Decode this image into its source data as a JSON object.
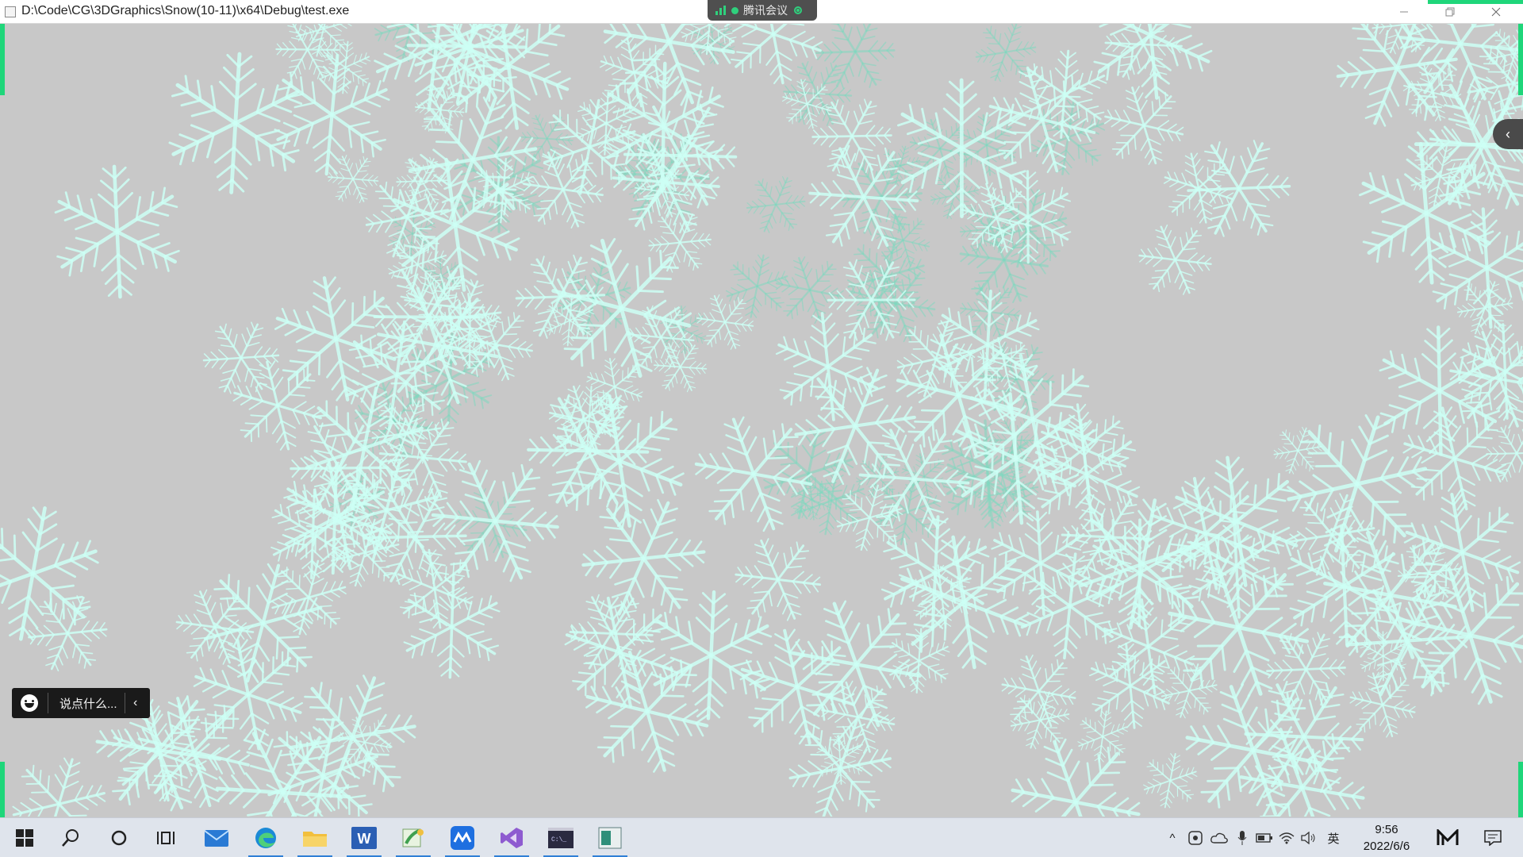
{
  "window": {
    "title": "D:\\Code\\CG\\3DGraphics\\Snow(10-11)\\x64\\Debug\\test.exe",
    "minimize_icon": "minimize-icon",
    "restore_icon": "restore-icon",
    "close_icon": "close-icon"
  },
  "meeting": {
    "label": "腾讯会议",
    "accent": "#2fd07d"
  },
  "canvas": {
    "background": "#c8c8c8",
    "content": "animated snowflakes",
    "flake_color": "#ccfff4",
    "flake_dim_color": "#7fd8bf"
  },
  "chat": {
    "placeholder": "说点什么...",
    "emoji_icon": "emoji-icon",
    "collapse_icon": "chevron-left-icon"
  },
  "side_tab": {
    "icon": "chevron-left-icon"
  },
  "taskbar": {
    "apps": [
      {
        "name": "start",
        "icon": "windows-icon"
      },
      {
        "name": "search",
        "icon": "search-icon"
      },
      {
        "name": "cortana",
        "icon": "cortana-icon"
      },
      {
        "name": "task-view",
        "icon": "task-view-icon"
      },
      {
        "name": "mail",
        "icon": "mail-icon"
      },
      {
        "name": "edge",
        "icon": "edge-icon"
      },
      {
        "name": "file-explorer",
        "icon": "folder-icon"
      },
      {
        "name": "word",
        "icon": "word-icon",
        "letter": "W"
      },
      {
        "name": "paint",
        "icon": "paint-icon"
      },
      {
        "name": "tencent-meeting",
        "icon": "meeting-icon"
      },
      {
        "name": "visual-studio",
        "icon": "visual-studio-icon"
      },
      {
        "name": "terminal",
        "icon": "terminal-icon",
        "letter": "C:\\_"
      },
      {
        "name": "test-app",
        "icon": "app-window-icon"
      }
    ],
    "tray": {
      "chevron": "^",
      "ime": "英",
      "time": "9:56",
      "date": "2022/6/6"
    }
  }
}
